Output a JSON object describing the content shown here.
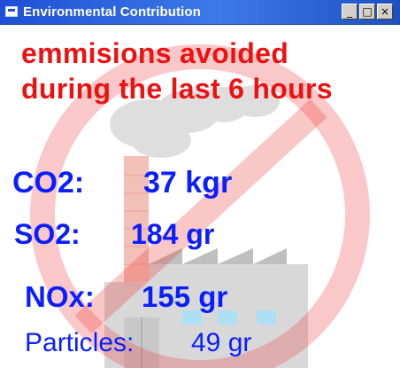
{
  "window": {
    "title": "Environmental Contribution",
    "controls": {
      "minimize_glyph": "_",
      "maximize_glyph": "□",
      "close_glyph": "×"
    }
  },
  "content": {
    "headline": "emmisions avoided during the last 6 hours",
    "stats": {
      "co2": {
        "label": "CO2:",
        "value": "37 kgr"
      },
      "so2": {
        "label": "SO2:",
        "value": "184 gr"
      },
      "nox": {
        "label": "NOx:",
        "value": "155 gr"
      },
      "particles": {
        "label": "Particles:",
        "value": "49 gr"
      }
    }
  },
  "colors": {
    "headline": "#ee1111",
    "stats": "#0a1eff",
    "titlebar": "#1f4fd6",
    "prohibition_sign": "#ee3a3a",
    "factory": "#d6d6d6"
  },
  "icons": {
    "app": "window-app-icon",
    "background": "no-factory-prohibition-icon"
  }
}
